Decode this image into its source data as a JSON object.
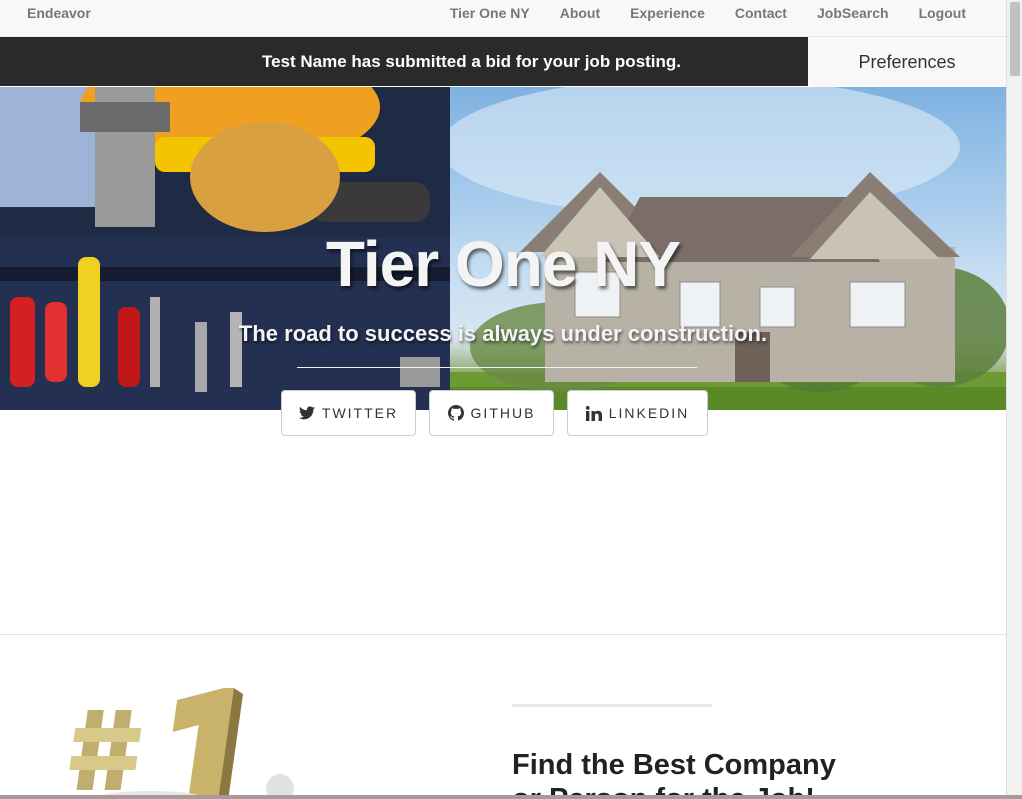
{
  "navbar": {
    "brand": "Endeavor",
    "links": [
      "Tier One NY",
      "About",
      "Experience",
      "Contact",
      "JobSearch",
      "Logout"
    ]
  },
  "notification": {
    "message": "Test Name has submitted a bid for your job posting.",
    "preferences_label": "Preferences"
  },
  "hero": {
    "title": "Tier One NY",
    "subtitle": "The road to success is always under construction."
  },
  "socials": [
    {
      "label": "TWITTER",
      "icon": "twitter-icon"
    },
    {
      "label": "GITHUB",
      "icon": "github-icon"
    },
    {
      "label": "LINKEDIN",
      "icon": "linkedin-icon"
    }
  ],
  "section": {
    "heading": "Find the Best Company or Person for the Job!"
  },
  "colors": {
    "notice_bg": "#2a2a2a",
    "navbar_bg": "#f8f8f8",
    "nav_text": "#777777"
  }
}
